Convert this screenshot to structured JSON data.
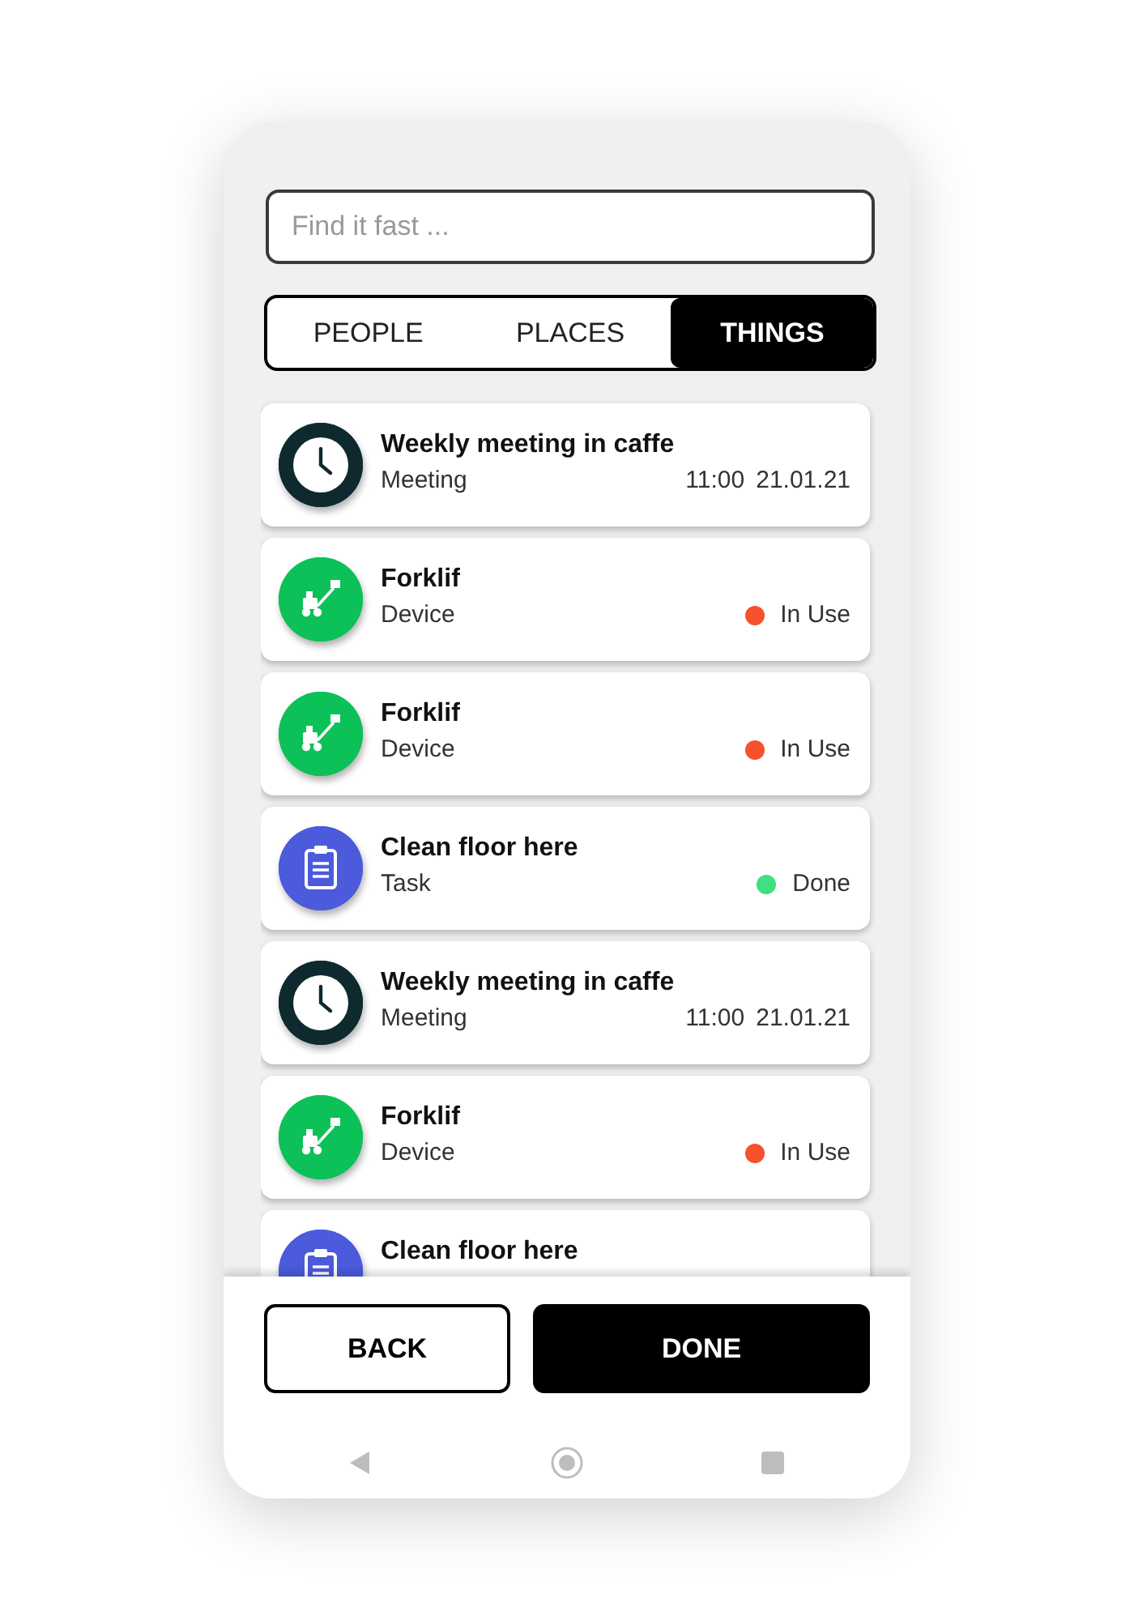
{
  "search": {
    "placeholder": "Find it fast ..."
  },
  "tabs": [
    {
      "label": "PEOPLE",
      "selected": false
    },
    {
      "label": "PLACES",
      "selected": false
    },
    {
      "label": "THINGS",
      "selected": true
    }
  ],
  "items": [
    {
      "kind": "meeting",
      "title": "Weekly meeting in caffe",
      "subtitle": "Meeting",
      "time": "11:00",
      "date": "21.01.21"
    },
    {
      "kind": "device",
      "title": "Forklif",
      "subtitle": "Device",
      "status": "In Use",
      "color": "#f4512c"
    },
    {
      "kind": "device",
      "title": "Forklif",
      "subtitle": "Device",
      "status": "In Use",
      "color": "#f4512c"
    },
    {
      "kind": "task",
      "title": "Clean floor here",
      "subtitle": "Task",
      "status": "Done",
      "color": "#3ee07f"
    },
    {
      "kind": "meeting",
      "title": "Weekly meeting in caffe",
      "subtitle": "Meeting",
      "time": "11:00",
      "date": "21.01.21"
    },
    {
      "kind": "device",
      "title": "Forklif",
      "subtitle": "Device",
      "status": "In Use",
      "color": "#f4512c"
    },
    {
      "kind": "task",
      "title": "Clean floor here"
    }
  ],
  "buttons": [
    {
      "kind": "outline",
      "label": "BACK"
    },
    {
      "kind": "filled",
      "label": "DONE"
    }
  ]
}
